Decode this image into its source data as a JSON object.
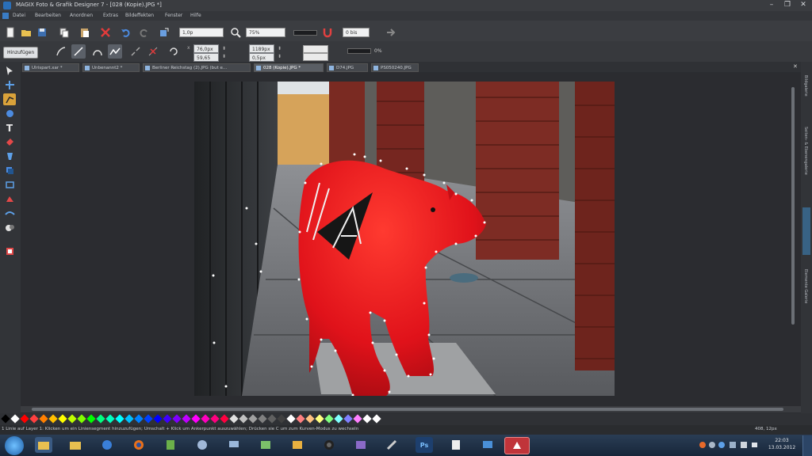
{
  "window": {
    "title": "MAGIX Foto & Grafik Designer 7 - [028 (Kopie).JPG *]",
    "controls": [
      "–",
      "❐",
      "✕"
    ]
  },
  "menu": [
    "Datei",
    "Bearbeiten",
    "Anordnen",
    "Extras",
    "Bildeffekten",
    "Fenster",
    "Hilfe"
  ],
  "toolbar": {
    "zoom_level": "75%",
    "zoom_field": "1,0p",
    "rotate_field": "0 bis"
  },
  "infobar": {
    "add_button": "Hinzufügen",
    "x_value": "76,0px",
    "y_value": "59,65",
    "w_value": "1189px",
    "h_value": "0,5px",
    "opacity": "0%"
  },
  "tabs": [
    {
      "label": "Ulrispart.xar *"
    },
    {
      "label": "Unbenannt2 *"
    },
    {
      "label": "Berliner Reichstag (2).JPG (but e..."
    },
    {
      "label": "028 (Kopie).JPG *",
      "active": true
    },
    {
      "label": "D74.JPG"
    },
    {
      "label": "PS050240.JPG"
    }
  ],
  "right_panel": [
    "Bildgalerie",
    "Seiten- & Ebenengalerie",
    "Elemente Galerie"
  ],
  "status": {
    "left": "1 Linie auf Layer 1: Klicken um ein Liniensegment hinzuzufügen; Umschalt + Klick um Ankerpunkt auszuwählen; Drücken sie C um zum Kurven-Modus zu wechseln",
    "right": "408, 12px"
  },
  "clock": {
    "time": "22:03",
    "date": "13.03.2012"
  },
  "colors": {
    "chrome_dark": "#2b2d31",
    "chrome_mid": "#3b3d41",
    "bear_red": "#e0121a",
    "brick": "#7a2a22",
    "taskbar": "#1e3048"
  },
  "icons": [
    "new-icon",
    "open-icon",
    "save-icon",
    "copy-icon",
    "paste-icon",
    "delete-icon",
    "undo-icon",
    "redo-icon",
    "zoom-icon",
    "magnet-icon",
    "arrow-right-icon"
  ],
  "palette_colors": [
    "#000000",
    "#ffffff",
    "#ff0000",
    "#ff4040",
    "#ff7f00",
    "#ffbf00",
    "#ffff00",
    "#bfff00",
    "#80ff00",
    "#00ff00",
    "#00ff80",
    "#00ffbf",
    "#00ffff",
    "#00bfff",
    "#0080ff",
    "#0040ff",
    "#0000ff",
    "#4000ff",
    "#8000ff",
    "#bf00ff",
    "#ff00ff",
    "#ff00bf",
    "#ff0080",
    "#ff0040",
    "#e0e0e0",
    "#c0c0c0",
    "#a0a0a0",
    "#808080",
    "#606060",
    "#404040",
    "#ffffff",
    "#ff8080",
    "#ffc080",
    "#ffff80",
    "#80ff80",
    "#80ffff",
    "#8080ff",
    "#ff80ff",
    "#ffffff",
    "#ffffff"
  ]
}
